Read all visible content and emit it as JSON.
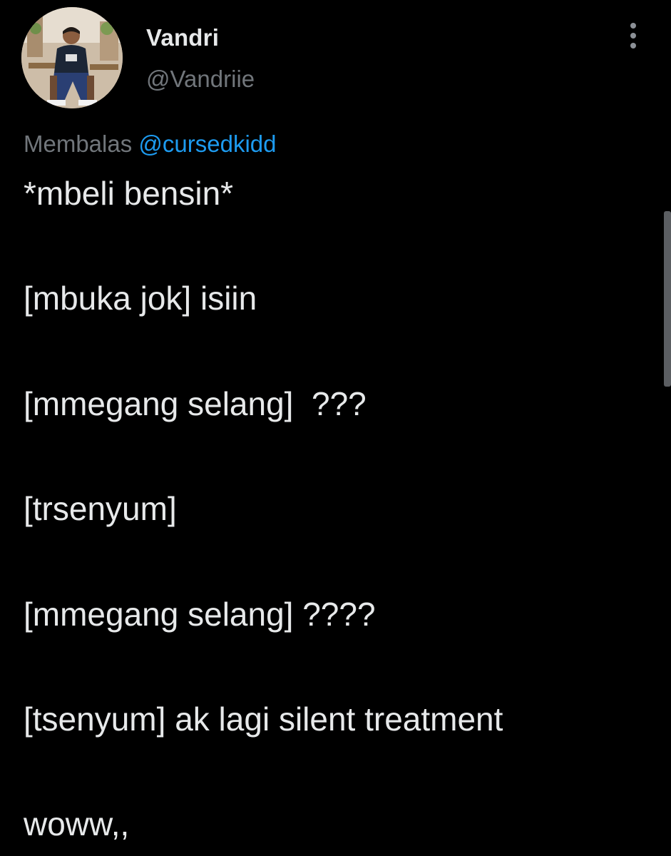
{
  "author": {
    "display_name": "Vandri",
    "handle": "@Vandriie",
    "avatar_icon": "profile-photo"
  },
  "reply_context": {
    "prefix": "Membalas",
    "mention": "@cursedkidd"
  },
  "tweet": {
    "lines": [
      "*mbeli bensin*",
      "[mbuka jok] isiin",
      "[mmegang selang]  ???",
      "[trsenyum]",
      "[mmegang selang] ????",
      "[tsenyum] ak lagi silent treatment",
      "woww,,"
    ]
  },
  "icons": {
    "more": "more-options-icon"
  },
  "colors": {
    "background": "#000000",
    "text_primary": "#e7e9ea",
    "text_secondary": "#71767b",
    "accent": "#1d9bf0"
  }
}
